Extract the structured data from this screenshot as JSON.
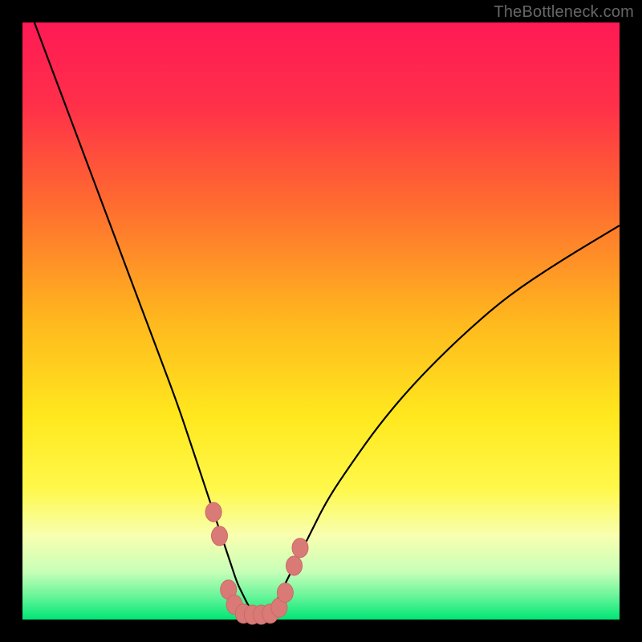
{
  "watermark": "TheBottleneck.com",
  "colors": {
    "gradient_stops": [
      {
        "pct": 0,
        "color": "#ff1a55"
      },
      {
        "pct": 14,
        "color": "#ff3049"
      },
      {
        "pct": 30,
        "color": "#ff6a30"
      },
      {
        "pct": 50,
        "color": "#ffb81e"
      },
      {
        "pct": 66,
        "color": "#ffe81e"
      },
      {
        "pct": 78,
        "color": "#fff84a"
      },
      {
        "pct": 86,
        "color": "#f8ffb0"
      },
      {
        "pct": 92,
        "color": "#c8ffb8"
      },
      {
        "pct": 96,
        "color": "#6af59a"
      },
      {
        "pct": 100,
        "color": "#00e676"
      }
    ],
    "curve": "#000000",
    "marker": "#d97a77",
    "frame": "#000000",
    "watermark": "#666666"
  },
  "chart_data": {
    "type": "line",
    "title": "",
    "xlabel": "",
    "ylabel": "",
    "xlim": [
      0,
      100
    ],
    "ylim": [
      0,
      100
    ],
    "grid": false,
    "legend": false,
    "annotations": [],
    "series": [
      {
        "name": "bottleneck-curve",
        "x": [
          2,
          5,
          8,
          11,
          14,
          17,
          20,
          23,
          26,
          28,
          30,
          32,
          33,
          34,
          35,
          36,
          37,
          38,
          39,
          40,
          41,
          42,
          43,
          44,
          46,
          48,
          51,
          55,
          60,
          66,
          73,
          81,
          90,
          100
        ],
        "values": [
          100,
          92,
          84,
          76,
          68,
          60,
          52,
          44,
          36,
          30,
          24,
          18,
          15,
          12,
          9,
          6,
          4,
          2,
          1,
          1,
          1,
          2,
          4,
          6,
          10,
          14,
          20,
          26,
          33,
          40,
          47,
          54,
          60,
          66
        ]
      }
    ],
    "markers": [
      {
        "x": 32.0,
        "y": 18.0
      },
      {
        "x": 33.0,
        "y": 14.0
      },
      {
        "x": 34.5,
        "y": 5.0
      },
      {
        "x": 35.5,
        "y": 2.5
      },
      {
        "x": 37.0,
        "y": 1.0
      },
      {
        "x": 38.5,
        "y": 0.8
      },
      {
        "x": 40.0,
        "y": 0.8
      },
      {
        "x": 41.5,
        "y": 1.0
      },
      {
        "x": 43.0,
        "y": 2.0
      },
      {
        "x": 44.0,
        "y": 4.5
      },
      {
        "x": 45.5,
        "y": 9.0
      },
      {
        "x": 46.5,
        "y": 12.0
      }
    ]
  }
}
